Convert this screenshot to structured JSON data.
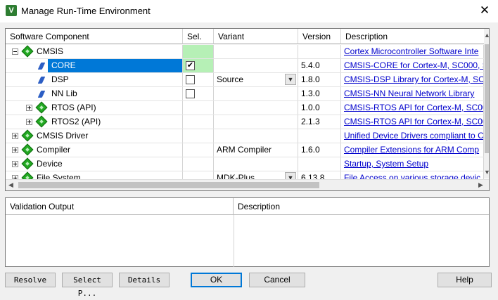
{
  "window": {
    "title": "Manage Run-Time Environment",
    "close_glyph": "✕",
    "app_icon_glyph": "V"
  },
  "columns": [
    "Software Component",
    "Sel.",
    "Variant",
    "Version",
    "Description"
  ],
  "rows": [
    {
      "component": "CMSIS",
      "selected": false,
      "variant": "",
      "version": "",
      "description": "Cortex Microcontroller Software Inte"
    },
    {
      "component": "CORE",
      "selected": true,
      "variant": "",
      "version": "5.4.0",
      "description": "CMSIS-CORE for Cortex-M, SC000, S"
    },
    {
      "component": "DSP",
      "selected": false,
      "variant": "Source",
      "version": "1.8.0",
      "description": "CMSIS-DSP Library for Cortex-M, SC"
    },
    {
      "component": "NN Lib",
      "selected": false,
      "variant": "",
      "version": "1.3.0",
      "description": "CMSIS-NN Neural Network Library"
    },
    {
      "component": "RTOS (API)",
      "selected": false,
      "variant": "",
      "version": "1.0.0",
      "description": "CMSIS-RTOS API for Cortex-M, SC00"
    },
    {
      "component": "RTOS2 (API)",
      "selected": false,
      "variant": "",
      "version": "2.1.3",
      "description": "CMSIS-RTOS API for Cortex-M, SC00"
    },
    {
      "component": "CMSIS Driver",
      "selected": false,
      "variant": "",
      "version": "",
      "description": "Unified Device Drivers compliant to C"
    },
    {
      "component": "Compiler",
      "selected": false,
      "variant": "ARM Compiler",
      "version": "1.6.0",
      "description": "Compiler Extensions for ARM Comp"
    },
    {
      "component": "Device",
      "selected": false,
      "variant": "",
      "version": "",
      "description": "Startup, System Setup"
    },
    {
      "component": "File System",
      "selected": false,
      "variant": "MDK-Plus",
      "version": "6.13.8",
      "description": "File Access on various storage devic"
    }
  ],
  "check_glyph": "✔",
  "dropdown_glyph": "▼",
  "scroll": {
    "up": "▲",
    "down": "▼",
    "left": "◀",
    "right": "▶"
  },
  "colors": {
    "selection": "#0078d7",
    "selected_cell": "#b6f0b6",
    "link": "#0000cc"
  },
  "lower_panel": {
    "col1": "Validation Output",
    "col2": "Description"
  },
  "buttons": {
    "resolve": "Resolve",
    "select_packs": "Select P...",
    "details": "Details",
    "ok": "OK",
    "cancel": "Cancel",
    "help": "Help"
  }
}
